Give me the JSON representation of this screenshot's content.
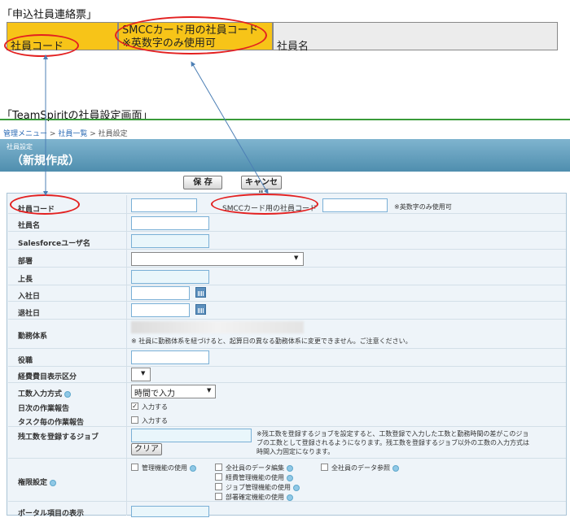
{
  "captions": {
    "application_slip": "「申込社員連絡票」",
    "teamspirit_screen": "「TeamSpiritの社員設定画面」"
  },
  "slip": {
    "employee_code": "社員コード",
    "smcc_line1": "SMCCカード用の社員コード",
    "smcc_line2": "※英数字のみ使用可",
    "employee_name": "社員名"
  },
  "breadcrumb": {
    "menu": "管理メニュー",
    "list": "社員一覧",
    "current": "社員設定",
    "sep": ">"
  },
  "title": {
    "small": "社員設定",
    "large": "（新規作成）"
  },
  "buttons": {
    "save": "保 存",
    "cancel": "キャンセル"
  },
  "form": {
    "employee_code": "社員コード",
    "smcc_code": "SMCCカード用の社員コード",
    "smcc_note": "※英数字のみ使用可",
    "employee_name": "社員名",
    "sf_user": "Salesforceユーザ名",
    "department": "部署",
    "boss": "上長",
    "join_date": "入社日",
    "leave_date": "退社日",
    "work_system": "勤務体系",
    "work_system_value": "（ぼかし）",
    "work_system_note": "※ 社員に勤務体系を紐づけると、起算日の異なる勤務体系に変更できません。ご注意ください。",
    "position": "役職",
    "expense_display": "経費費目表示区分",
    "labor_input": "工数入力方式",
    "labor_input_value": "時間で入力",
    "daily_report": "日次の作業報告",
    "daily_report_opt": "入力する",
    "task_report": "タスク毎の作業報告",
    "task_report_opt": "入力する",
    "remaining_job": "残工数を登録するジョブ",
    "clear": "クリア",
    "remaining_note_1": "※残工数を登録するジョブを設定すると、工数登録で入力した工数と勤務時間の差がこのジョ",
    "remaining_note_2": "ブの工数として登録されるようになります。残工数を登録するジョブ以外の工数の入力方式は",
    "remaining_note_3": "時間入力固定になります。",
    "permissions": "権限設定",
    "perm_admin": "管理機能の使用",
    "perm_all_edit": "全社員のデータ編集",
    "perm_all_view": "全社員のデータ参照",
    "perm_expense": "経費管理機能の使用",
    "perm_job": "ジョブ管理機能の使用",
    "perm_dept": "部署確定機能の使用",
    "cut_row": "ポータル項目の表示"
  },
  "colors": {
    "highlight": "#f7c418",
    "annotation": "#e32020",
    "header": "#5f9bbb",
    "breadcrumb_line": "#3a9b3a"
  }
}
